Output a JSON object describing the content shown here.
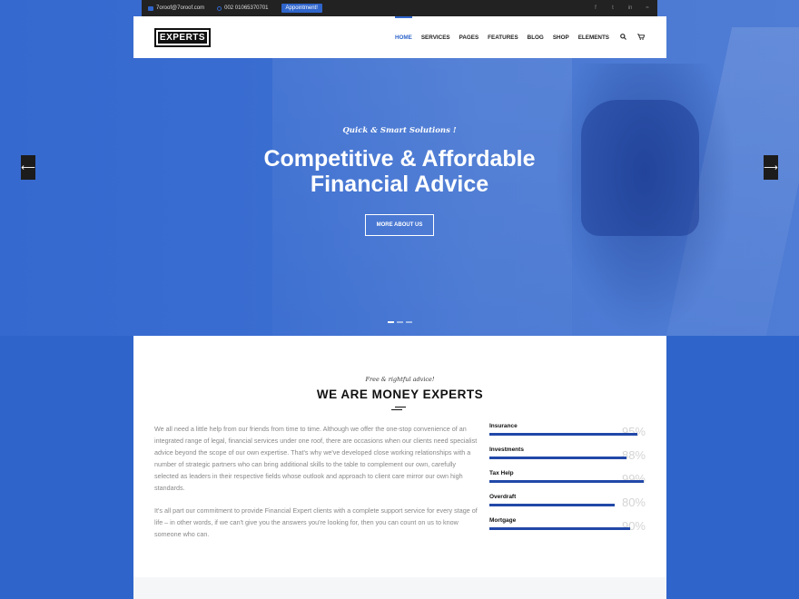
{
  "topbar": {
    "email": "7oroof@7oroof.com",
    "phone": "002 01065370701",
    "appointment": "Appointment!"
  },
  "logo": "EXPERTS",
  "nav": [
    "HOME",
    "SERVICES",
    "PAGES",
    "FEATURES",
    "BLOG",
    "SHOP",
    "ELEMENTS"
  ],
  "hero": {
    "eyebrow": "Quick & Smart Solutions !",
    "headline_line1": "Competitive & Affordable",
    "headline_line2": "Financial Advice",
    "button": "MORE ABOUT US"
  },
  "about": {
    "tagline": "Free & rightful advice!",
    "title": "WE ARE MONEY EXPERTS",
    "para1": "We all need a little help from our friends from time to time. Although we offer the one-stop convenience of an integrated range of legal, financial services under one roof, there are occasions when our clients need specialist advice beyond the scope of our own expertise. That's why we've developed close working relationships with a number of strategic partners who can bring additional skills to the table to complement our own, carefully selected as leaders in their respective fields whose outlook and approach to client care mirror our own high standards.",
    "para2": "It's all part our commitment to provide Financial Expert clients with a complete support service for every stage of life – in other words, if we can't give you the answers you're looking for, then you can count on us to know someone who can."
  },
  "skills": [
    {
      "label": "Insurance",
      "pct": "95%",
      "value": 95
    },
    {
      "label": "Investments",
      "pct": "88%",
      "value": 88
    },
    {
      "label": "Tax Help",
      "pct": "99%",
      "value": 99
    },
    {
      "label": "Overdraft",
      "pct": "80%",
      "value": 80
    },
    {
      "label": "Mortgage",
      "pct": "90%",
      "value": 90
    }
  ],
  "colors": {
    "accent": "#2f65cb",
    "dark": "#222222"
  }
}
